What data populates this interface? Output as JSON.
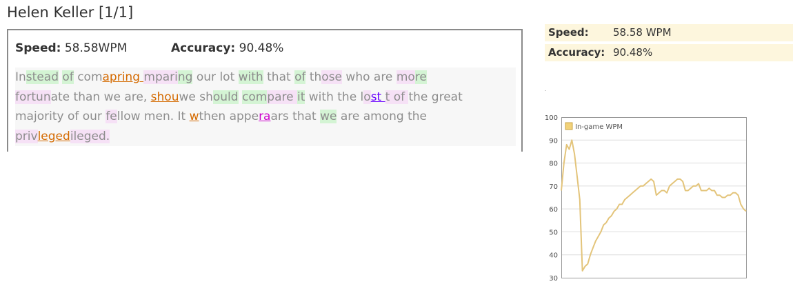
{
  "header": {
    "title": "Helen Keller [1/1]"
  },
  "stats": {
    "speed_label": "Speed:",
    "speed_value": "58.58WPM",
    "accuracy_label": "Accuracy:",
    "accuracy_value": "90.48%"
  },
  "typed_lines": [
    [
      {
        "t": "In",
        "c": ""
      },
      {
        "t": "stead",
        "c": "g"
      },
      {
        "t": " ",
        "c": ""
      },
      {
        "t": "of",
        "c": "g"
      },
      {
        "t": " com",
        "c": ""
      },
      {
        "t": "apring ",
        "c": "e"
      },
      {
        "t": "mpari",
        "c": "p"
      },
      {
        "t": "ng",
        "c": "g"
      },
      {
        "t": " our lot ",
        "c": ""
      },
      {
        "t": "with",
        "c": "g"
      },
      {
        "t": " that ",
        "c": ""
      },
      {
        "t": "of",
        "c": "g"
      },
      {
        "t": " th",
        "c": ""
      },
      {
        "t": "ose",
        "c": "p"
      },
      {
        "t": " who are ",
        "c": ""
      },
      {
        "t": "mo",
        "c": "p"
      },
      {
        "t": "re",
        "c": "g"
      }
    ],
    [
      {
        "t": "fortun",
        "c": "p"
      },
      {
        "t": "ate than we are, ",
        "c": ""
      },
      {
        "t": "shou",
        "c": "e"
      },
      {
        "t": "we sh",
        "c": ""
      },
      {
        "t": "ould",
        "c": "g"
      },
      {
        "t": " ",
        "c": ""
      },
      {
        "t": "com",
        "c": "g"
      },
      {
        "t": "pare ",
        "c": "p"
      },
      {
        "t": "it",
        "c": "g"
      },
      {
        "t": " with the l",
        "c": ""
      },
      {
        "t": "o",
        "c": "p"
      },
      {
        "t": "st ",
        "c": "v"
      },
      {
        "t": "t of ",
        "c": "p"
      },
      {
        "t": "the great",
        "c": ""
      }
    ],
    [
      {
        "t": "majority of our ",
        "c": ""
      },
      {
        "t": "fe",
        "c": "p"
      },
      {
        "t": "llow men. It ",
        "c": ""
      },
      {
        "t": "w",
        "c": "e"
      },
      {
        "t": "then appe",
        "c": ""
      },
      {
        "t": "ra",
        "c": "x"
      },
      {
        "t": "ars that ",
        "c": ""
      },
      {
        "t": "we",
        "c": "g"
      },
      {
        "t": " are among the",
        "c": ""
      }
    ],
    [
      {
        "t": "priv",
        "c": "p"
      },
      {
        "t": "leged",
        "c": "e"
      },
      {
        "t": "ileged.",
        "c": "p"
      }
    ]
  ],
  "summary": {
    "speed_label": "Speed:",
    "speed_value": "58.58 WPM",
    "accuracy_label": "Accuracy:",
    "accuracy_value": "90.48%"
  },
  "colors": {
    "line": "#e3c47a",
    "legend_fill": "#f2d27a",
    "legend_border": "#c9a445",
    "grid": "#dddddd",
    "frame": "#999999"
  },
  "chart_data": {
    "type": "line",
    "title": "",
    "xlabel": "",
    "ylabel": "",
    "ylim": [
      30,
      100
    ],
    "yticks": [
      30,
      40,
      50,
      60,
      70,
      80,
      90,
      100
    ],
    "grid": true,
    "legend_position": "top-left",
    "series": [
      {
        "name": "In-game WPM",
        "values": [
          68,
          80,
          88,
          86,
          90,
          84,
          74,
          64,
          33,
          35,
          36,
          40,
          43,
          46,
          48,
          50,
          53,
          54,
          56,
          57,
          59,
          60,
          62,
          62,
          64,
          65,
          66,
          67,
          68,
          69,
          70,
          70,
          71,
          72,
          73,
          72,
          66,
          67,
          68,
          68,
          67,
          70,
          71,
          72,
          73,
          73,
          72,
          68,
          68,
          69,
          70,
          70,
          71,
          68,
          68,
          68,
          69,
          68,
          68,
          66,
          66,
          65,
          65,
          66,
          66,
          67,
          67,
          66,
          62,
          60,
          59
        ]
      }
    ]
  }
}
